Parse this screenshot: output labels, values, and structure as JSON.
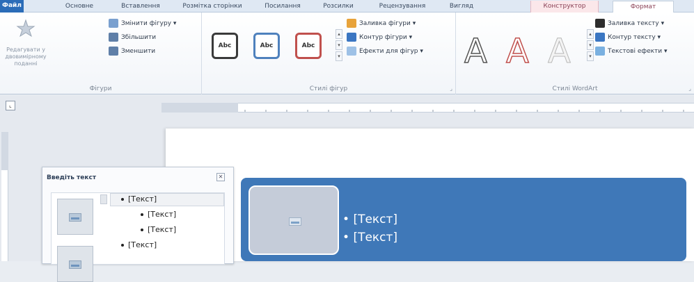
{
  "tabs": [
    {
      "label": "Файл"
    },
    {
      "label": "Основне"
    },
    {
      "label": "Вставлення"
    },
    {
      "label": "Розмітка сторінки"
    },
    {
      "label": "Посилання"
    },
    {
      "label": "Розсилки"
    },
    {
      "label": "Рецензування"
    },
    {
      "label": "Вигляд"
    },
    {
      "label": "Конструктор"
    },
    {
      "label": "Формат"
    }
  ],
  "ribbon": {
    "shapes_group": {
      "label": "Фігури",
      "edit_in_2d": "Редагувати у двовимірному поданні",
      "change_shape": "Змінити фігуру",
      "enlarge": "Збільшити",
      "shrink": "Зменшити"
    },
    "shape_styles_group": {
      "label": "Стилі фігур",
      "style_sample": "Abc",
      "fill": "Заливка фігури",
      "outline": "Контур фігури",
      "effects": "Ефекти для фігур"
    },
    "wordart_group": {
      "label": "Стилі WordArt",
      "letter": "A",
      "text_fill": "Заливка тексту",
      "text_outline": "Контур тексту",
      "text_effects": "Текстові ефекти"
    }
  },
  "text_pane": {
    "title": "Введіть текст",
    "items": [
      "[Текст]",
      "[Текст]",
      "[Текст]",
      "[Текст]"
    ]
  },
  "smartart": {
    "items": [
      "[Текст]",
      "[Текст]"
    ]
  },
  "colors": {
    "accent": "#2b6cb8",
    "smartart_fill": "#3f78b8",
    "context_tab": "#fbe7ea"
  }
}
